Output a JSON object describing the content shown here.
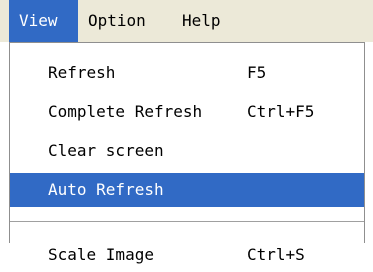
{
  "menubar": {
    "items": [
      {
        "label": "View",
        "state": "open"
      },
      {
        "label": "Option"
      },
      {
        "label": "Help"
      }
    ]
  },
  "view_menu": {
    "items": [
      {
        "label": "Refresh",
        "shortcut": "F5"
      },
      {
        "label": "Complete Refresh",
        "shortcut": "Ctrl+F5"
      },
      {
        "label": "Clear screen"
      },
      {
        "label": "Auto Refresh",
        "state": "highlighted"
      },
      {
        "label": "Scale Image",
        "shortcut": "Ctrl+S"
      }
    ]
  },
  "colors": {
    "highlight": "#316ac5",
    "menubar_bg": "#ece9d8",
    "menu_bg": "#ffffff"
  }
}
